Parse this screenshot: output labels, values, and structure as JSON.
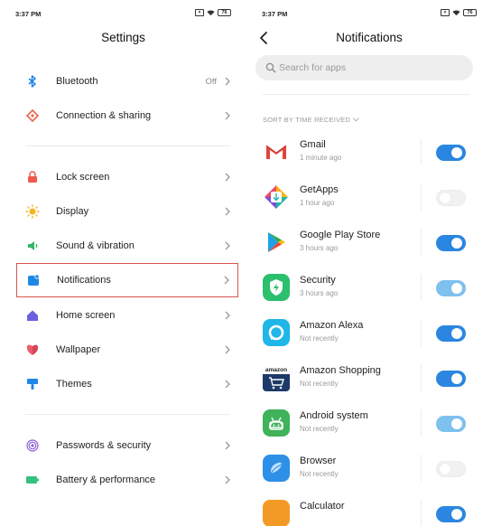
{
  "settings_screen": {
    "status_time": "3:37 PM",
    "battery": "76",
    "title": "Settings",
    "items": [
      {
        "label": "Bluetooth",
        "value": "Off"
      },
      {
        "label": "Connection & sharing"
      },
      {
        "label": "Lock screen"
      },
      {
        "label": "Display"
      },
      {
        "label": "Sound & vibration"
      },
      {
        "label": "Notifications"
      },
      {
        "label": "Home screen"
      },
      {
        "label": "Wallpaper"
      },
      {
        "label": "Themes"
      },
      {
        "label": "Passwords & security"
      },
      {
        "label": "Battery & performance"
      }
    ]
  },
  "notifications_screen": {
    "status_time": "3:37 PM",
    "battery": "76",
    "title": "Notifications",
    "search_placeholder": "Search for apps",
    "sort_label": "SORT BY TIME RECEIVED",
    "apps": [
      {
        "name": "Gmail",
        "time": "1 minute ago",
        "state": "on"
      },
      {
        "name": "GetApps",
        "time": "1 hour ago",
        "state": "off"
      },
      {
        "name": "Google Play Store",
        "time": "3 hours ago",
        "state": "on"
      },
      {
        "name": "Security",
        "time": "3 hours ago",
        "state": "on-dim"
      },
      {
        "name": "Amazon Alexa",
        "time": "Not recently",
        "state": "on"
      },
      {
        "name": "Amazon Shopping",
        "time": "Not recently",
        "state": "on"
      },
      {
        "name": "Android system",
        "time": "Not recently",
        "state": "on-dim"
      },
      {
        "name": "Browser",
        "time": "Not recently",
        "state": "off"
      },
      {
        "name": "Calculator",
        "time": "",
        "state": "on"
      }
    ]
  },
  "colors": {
    "accent": "#2a86e0",
    "highlight_border": "#d9534f"
  }
}
